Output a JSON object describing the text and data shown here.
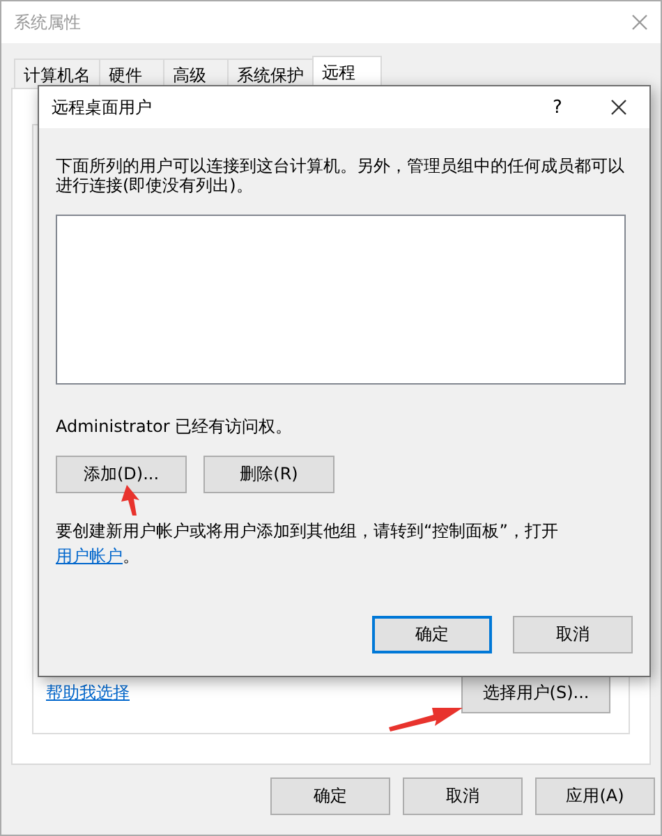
{
  "window": {
    "title": "系统属性"
  },
  "tabs": [
    {
      "label": "计算机名",
      "selected": false
    },
    {
      "label": "硬件",
      "selected": false
    },
    {
      "label": "高级",
      "selected": false
    },
    {
      "label": "系统保护",
      "selected": false
    },
    {
      "label": "远程",
      "selected": true
    }
  ],
  "remote_panel": {
    "help_link": "帮助我选择",
    "select_users_button": "选择用户(S)..."
  },
  "buttons": [
    "确定",
    "取消",
    "应用(A)"
  ],
  "dialog": {
    "title": "远程桌面用户",
    "help_button": "?",
    "description": "下面所列的用户可以连接到这台计算机。另外，管理员组中的任何成员都可以进行连接(即使没有列出)。",
    "access_note": "Administrator 已经有访问权。",
    "buttons": [
      "添加(D)...",
      "删除(R)"
    ],
    "hint": "要创建新用户帐户或将用户添加到其他组，请转到“控制面板”，打开",
    "hint_link": "用户帐户",
    "hint_end": "。",
    "ok_button": "确定",
    "cancel_button": "取消"
  }
}
